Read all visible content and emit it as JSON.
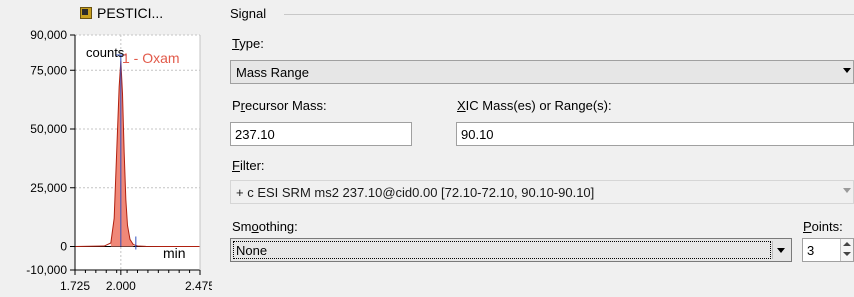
{
  "chromatogram": {
    "title": "PESTICI...",
    "counts_label": "counts",
    "peak_label": "1 - Oxam",
    "x_unit": "min",
    "colors": {
      "fill": "#f08878",
      "outline": "#b02010",
      "label": "#e25a4a",
      "marker": "#3050c0"
    }
  },
  "chart_data": {
    "type": "area",
    "x_ticks": [
      "1.725",
      "2.000",
      "2.475"
    ],
    "y_ticks": [
      "90,000",
      "75,000",
      "50,000",
      "25,000",
      "0",
      "-10,000"
    ],
    "xlim": [
      1.725,
      2.475
    ],
    "ylim": [
      -10000,
      90000
    ],
    "xlabel": "min",
    "ylabel": "counts",
    "grid": true,
    "series": [
      {
        "name": "1 - Oxam",
        "x": [
          1.725,
          1.9,
          1.94,
          1.96,
          1.975,
          1.99,
          2.0,
          2.01,
          2.02,
          2.03,
          2.04,
          2.055,
          2.075,
          2.1,
          2.15,
          2.25,
          2.35,
          2.475
        ],
        "y": [
          0,
          200,
          1500,
          12000,
          40000,
          68000,
          79000,
          65000,
          40000,
          20000,
          9000,
          3000,
          800,
          200,
          50,
          0,
          0,
          0
        ]
      }
    ]
  },
  "signal": {
    "group_title": "Signal",
    "type": {
      "label_ul": "T",
      "label_rest": "ype:",
      "value": "Mass Range"
    },
    "precursor": {
      "label_pre": "P",
      "label_ul": "r",
      "label_rest": "ecursor Mass:",
      "value": "237.10"
    },
    "xic": {
      "label_ul": "X",
      "label_rest": "IC Mass(es) or Range(s):",
      "value": "90.10"
    },
    "filter": {
      "label_ul": "F",
      "label_rest": "ilter:",
      "value": "+ c ESI SRM ms2 237.10@cid0.00 [72.10-72.10, 90.10-90.10]"
    },
    "smoothing": {
      "label_pre": "Sm",
      "label_ul": "o",
      "label_rest": "othing:",
      "value": "None"
    },
    "points": {
      "label_ul": "P",
      "label_rest": "oints:",
      "value": "3"
    }
  }
}
